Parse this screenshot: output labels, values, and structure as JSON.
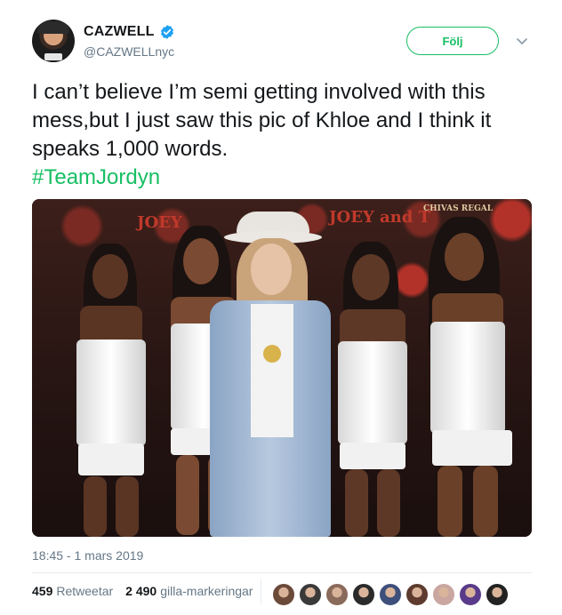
{
  "author": {
    "display_name": "CAZWELL",
    "handle": "@CAZWELLnyc",
    "verified_icon": "verified-badge-icon"
  },
  "actions": {
    "follow_label": "Följ",
    "more_icon": "chevron-down-icon"
  },
  "tweet": {
    "text": "I can’t believe I’m semi getting involved with this mess,but I just saw this pic of Khloe and I think it speaks 1,000 words.",
    "hashtag": "#TeamJordyn",
    "timestamp": "18:45 - 1 mars 2019"
  },
  "photo": {
    "sign_left": "JOEY",
    "sign_right": "JOEY and T",
    "sign_badge": "CHIVAS REGAL"
  },
  "stats": {
    "retweets_count": "459",
    "retweets_label": "Retweetar",
    "likes_count": "2 490",
    "likes_label": "gilla-markeringar"
  },
  "likers": [
    "#6b4a3a",
    "#3a3a3a",
    "#8a6a5a",
    "#2b2b2b",
    "#3d4f7a",
    "#5e3b2e",
    "#c9a7a0",
    "#5a3a8a",
    "#222222"
  ],
  "colors": {
    "accent": "#17bf63",
    "verified": "#1da1f2",
    "secondary_text": "#657786"
  }
}
